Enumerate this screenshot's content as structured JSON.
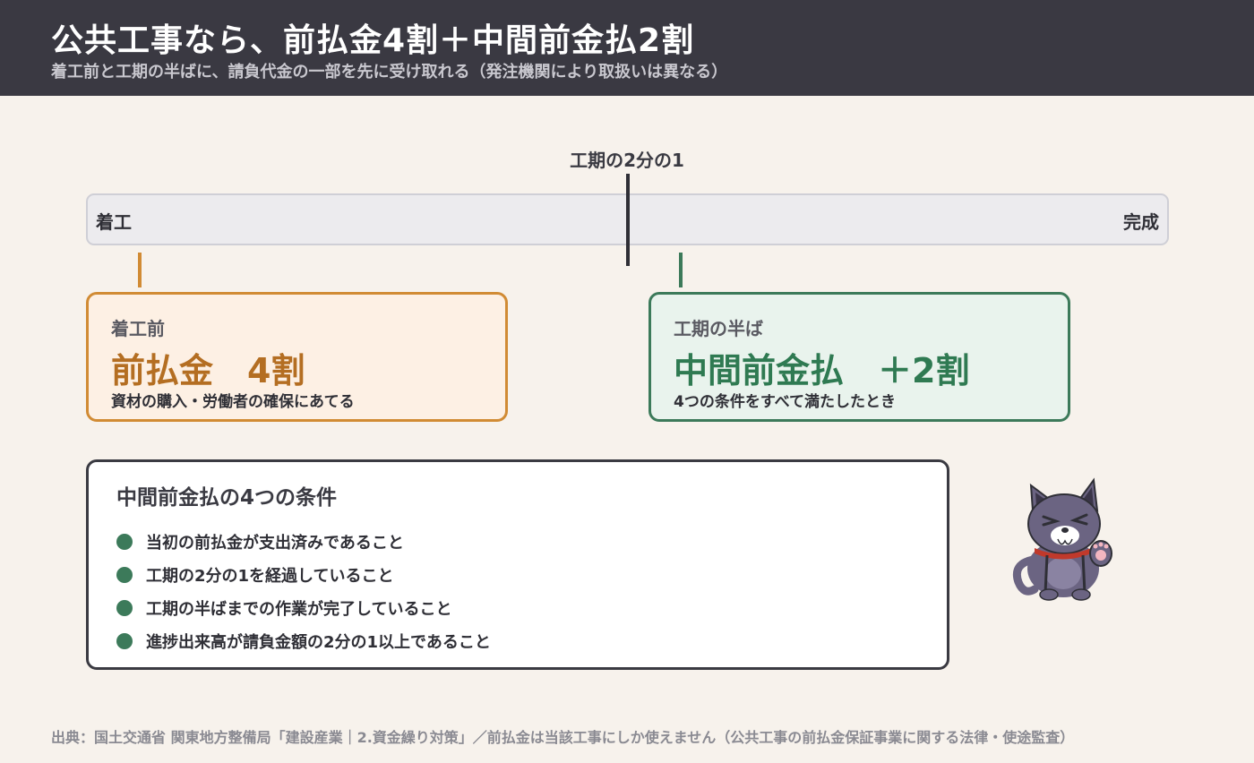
{
  "header": {
    "title": "公共工事なら、前払金4割＋中間前金払2割",
    "subtitle": "着工前と工期の半ばに、請負代金の一部を先に受け取れる（発注機関により取扱いは異なる）"
  },
  "timeline": {
    "start_label": "着工",
    "end_label": "完成",
    "midpoint_label": "工期の2分の1"
  },
  "stages": {
    "before": {
      "label": "着工前",
      "amount": "前払金　4割",
      "note": "資材の購入・労働者の確保にあてる",
      "color": "#d18b34"
    },
    "mid": {
      "label": "工期の半ば",
      "amount": "中間前金払　＋2割",
      "note": "4つの条件をすべて満たしたとき",
      "color": "#3c7a5a"
    }
  },
  "conditions": {
    "title": "中間前金払の4つの条件",
    "items": [
      "当初の前払金が支出済みであること",
      "工期の2分の1を経過していること",
      "工期の半ばまでの作業が完了していること",
      "進捗出来高が請負金額の2分の1以上であること"
    ]
  },
  "mascot": {
    "icon": "cat-mascot-icon"
  },
  "footer": {
    "source": "出典：国土交通省 関東地方整備局「建設産業｜2.資金繰り対策」／前払金は当該工事にしか使えません（公共工事の前払金保証事業に関する法律・使途監査）"
  }
}
